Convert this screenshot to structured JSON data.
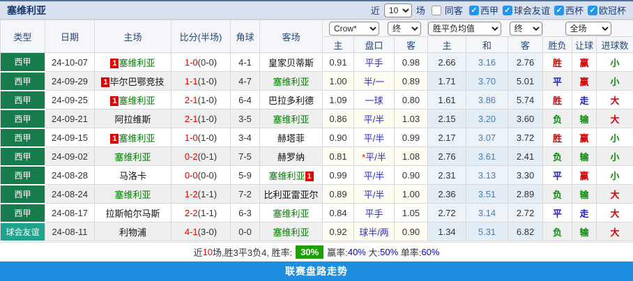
{
  "colors": {
    "league_green": "#177C4B",
    "friendly_teal": "#1FA38C",
    "sevilla_green": "#008000",
    "checkbox_blue": "#2196F3",
    "footer_blue": "#1E8FE0",
    "win_rate_badge_green": "#1F9E06",
    "score_red": "#E60000",
    "handicap_blue": "#2B2BC8"
  },
  "header": {
    "title": "塞维利亚",
    "filter": {
      "recent_label": "近",
      "recent_value": "10",
      "matches_label": "场",
      "same_venue_label": "同客",
      "leagues": [
        {
          "label": "西甲",
          "checked": true
        },
        {
          "label": "球会友谊",
          "checked": true
        },
        {
          "label": "西杯",
          "checked": true
        },
        {
          "label": "欧冠杯",
          "checked": true
        }
      ]
    }
  },
  "table": {
    "selects": {
      "company": "Crow*",
      "final_a": "终",
      "avg": "胜平负均值",
      "final_b": "终",
      "scope": "全场"
    },
    "columns": [
      "类型",
      "日期",
      "主场",
      "比分(半场)",
      "角球",
      "客场",
      "主",
      "盘口",
      "客",
      "主",
      "和",
      "客",
      "胜负",
      "让球",
      "进球数"
    ],
    "rows": [
      {
        "type": "西甲",
        "date": "24-10-07",
        "home_badge": "1",
        "home": "塞维利亚",
        "score": "1-0",
        "half": "(0-0)",
        "corner": "4-1",
        "away": "皇家贝蒂斯",
        "away_badge": "",
        "h": "0.91",
        "pan_star": "",
        "pan": "平手",
        "a": "0.98",
        "avg_h": "2.66",
        "avg_d": "3.16",
        "avg_a": "2.76",
        "res": "胜",
        "let": "赢",
        "goal": "小"
      },
      {
        "type": "西甲",
        "date": "24-09-29",
        "home_badge": "1",
        "home": "毕尔巴鄂竞技",
        "score": "1-1",
        "half": "(1-0)",
        "corner": "4-7",
        "away": "塞维利亚",
        "away_badge": "",
        "h": "1.00",
        "pan_star": "",
        "pan": "半/一",
        "a": "0.89",
        "avg_h": "1.71",
        "avg_d": "3.70",
        "avg_a": "5.01",
        "res": "平",
        "let": "赢",
        "goal": "小"
      },
      {
        "type": "西甲",
        "date": "24-09-25",
        "home_badge": "1",
        "home": "塞维利亚",
        "score": "2-1",
        "half": "(1-0)",
        "corner": "6-4",
        "away": "巴拉多利德",
        "away_badge": "",
        "h": "1.09",
        "pan_star": "",
        "pan": "一球",
        "a": "0.80",
        "avg_h": "1.61",
        "avg_d": "3.86",
        "avg_a": "5.74",
        "res": "胜",
        "let": "走",
        "goal": "大"
      },
      {
        "type": "西甲",
        "date": "24-09-21",
        "home_badge": "",
        "home": "阿拉维斯",
        "score": "2-1",
        "half": "(1-0)",
        "corner": "3-5",
        "away": "塞维利亚",
        "away_badge": "",
        "h": "0.86",
        "pan_star": "",
        "pan": "平/半",
        "a": "1.03",
        "avg_h": "2.15",
        "avg_d": "3.20",
        "avg_a": "3.60",
        "res": "负",
        "let": "输",
        "goal": "大"
      },
      {
        "type": "西甲",
        "date": "24-09-15",
        "home_badge": "1",
        "home": "塞维利亚",
        "score": "1-0",
        "half": "(1-0)",
        "corner": "3-4",
        "away": "赫塔菲",
        "away_badge": "",
        "h": "0.90",
        "pan_star": "",
        "pan": "平/半",
        "a": "0.99",
        "avg_h": "2.17",
        "avg_d": "3.07",
        "avg_a": "3.72",
        "res": "胜",
        "let": "赢",
        "goal": "小"
      },
      {
        "type": "西甲",
        "date": "24-09-02",
        "home_badge": "",
        "home": "塞维利亚",
        "score": "0-2",
        "half": "(0-1)",
        "corner": "7-5",
        "away": "赫罗纳",
        "away_badge": "",
        "h": "0.81",
        "pan_star": "*",
        "pan": "平/半",
        "a": "1.08",
        "avg_h": "2.76",
        "avg_d": "3.61",
        "avg_a": "2.41",
        "res": "负",
        "let": "输",
        "goal": "小"
      },
      {
        "type": "西甲",
        "date": "24-08-28",
        "home_badge": "",
        "home": "马洛卡",
        "score": "0-0",
        "half": "(0-0)",
        "corner": "5-9",
        "away": "塞维利亚",
        "away_badge": "1",
        "h": "0.99",
        "pan_star": "",
        "pan": "平/半",
        "a": "0.90",
        "avg_h": "2.31",
        "avg_d": "3.13",
        "avg_a": "3.30",
        "res": "平",
        "let": "赢",
        "goal": "小"
      },
      {
        "type": "西甲",
        "date": "24-08-24",
        "home_badge": "",
        "home": "塞维利亚",
        "score": "1-2",
        "half": "(1-1)",
        "corner": "7-2",
        "away": "比利亚雷亚尔",
        "away_badge": "",
        "h": "0.89",
        "pan_star": "",
        "pan": "平/半",
        "a": "1.00",
        "avg_h": "2.36",
        "avg_d": "3.51",
        "avg_a": "2.89",
        "res": "负",
        "let": "输",
        "goal": "大"
      },
      {
        "type": "西甲",
        "date": "24-08-17",
        "home_badge": "",
        "home": "拉斯帕尔马斯",
        "score": "2-2",
        "half": "(1-1)",
        "corner": "6-3",
        "away": "塞维利亚",
        "away_badge": "",
        "h": "0.84",
        "pan_star": "",
        "pan": "平手",
        "a": "1.05",
        "avg_h": "2.72",
        "avg_d": "3.14",
        "avg_a": "2.72",
        "res": "平",
        "let": "走",
        "goal": "大"
      },
      {
        "type": "球会友谊",
        "date": "24-08-11",
        "home_badge": "",
        "home": "利物浦",
        "score": "4-1",
        "half": "(3-0)",
        "corner": "0-0",
        "away": "塞维利亚",
        "away_badge": "",
        "h": "0.92",
        "pan_star": "",
        "pan": "球半/两",
        "a": "0.90",
        "avg_h": "1.34",
        "avg_d": "5.31",
        "avg_a": "6.82",
        "res": "负",
        "let": "输",
        "goal": "大"
      }
    ]
  },
  "summary": {
    "part1": "近",
    "count": "10",
    "part2": "场,胜3平3负4, 胜率:",
    "win_rate": "30%",
    "label2": "赢率:",
    "val2": "40%",
    "sep2": " ",
    "label3": "大:",
    "val3": "50%",
    "sep3": " ",
    "label4": "单率:",
    "val4": "60%"
  },
  "footer": {
    "label": "联赛盘路走势"
  }
}
